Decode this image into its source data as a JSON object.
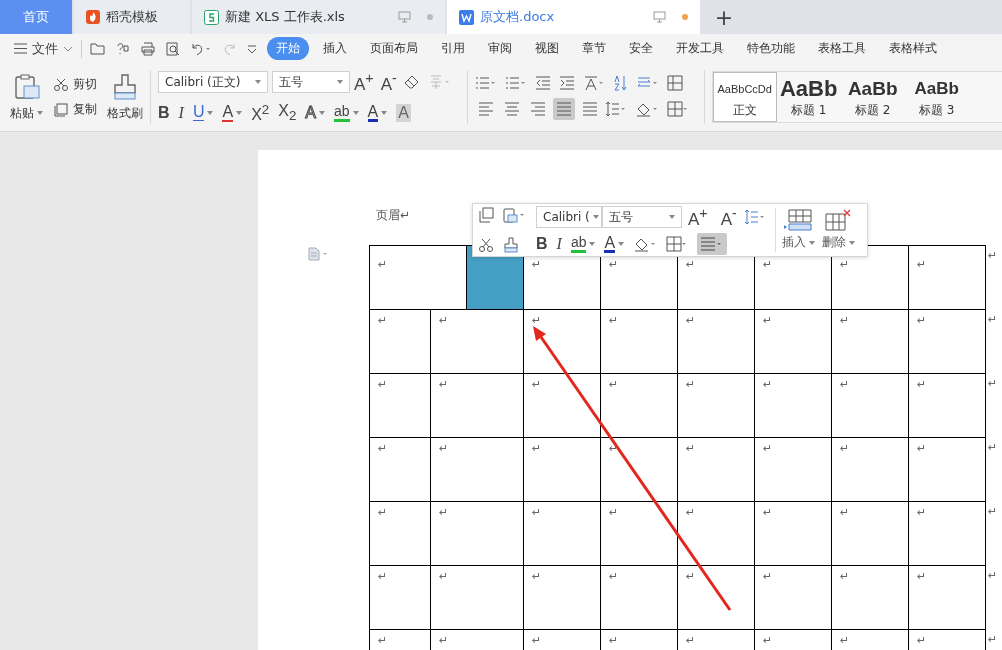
{
  "tabs": [
    {
      "label": "首页",
      "kind": "home",
      "selected": false
    },
    {
      "label": "稻壳模板",
      "kind": "docer",
      "selected": false
    },
    {
      "label": "新建 XLS 工作表.xls",
      "kind": "sheet",
      "selected": false,
      "modified": false
    },
    {
      "label": "原文档.docx",
      "kind": "writer",
      "selected": true,
      "modified": true
    }
  ],
  "new_tab": "+",
  "file_menu": "文件",
  "menu_tabs": [
    {
      "label": "开始",
      "selected": true
    },
    {
      "label": "插入",
      "selected": false
    },
    {
      "label": "页面布局",
      "selected": false
    },
    {
      "label": "引用",
      "selected": false
    },
    {
      "label": "审阅",
      "selected": false
    },
    {
      "label": "视图",
      "selected": false
    },
    {
      "label": "章节",
      "selected": false
    },
    {
      "label": "安全",
      "selected": false
    },
    {
      "label": "开发工具",
      "selected": false
    },
    {
      "label": "特色功能",
      "selected": false
    },
    {
      "label": "表格工具",
      "selected": false
    },
    {
      "label": "表格样式",
      "selected": false
    }
  ],
  "clipboard": {
    "paste": "粘贴",
    "cut": "剪切",
    "copy": "复制",
    "format_painter": "格式刷"
  },
  "font": {
    "family": "Calibri (正文)",
    "size": "五号",
    "grow_shrink": [
      "A$^{+}$",
      "A$^{-}$"
    ]
  },
  "format_buttons": [
    {
      "glyph": "B",
      "kind": "bold",
      "dropdown": false
    },
    {
      "glyph": "I",
      "kind": "italic",
      "dropdown": false
    },
    {
      "glyph": "U",
      "kind": "underline",
      "dropdown": true
    },
    {
      "glyph": "A",
      "kind": "strike",
      "dropdown": true
    },
    {
      "glyph": "X$^{2}$",
      "kind": "plain",
      "dropdown": false
    },
    {
      "glyph": "X$_{2}$",
      "kind": "plain",
      "dropdown": false
    },
    {
      "glyph": "A",
      "kind": "outline",
      "dropdown": true
    },
    {
      "glyph": "ab",
      "kind": "highlight",
      "dropdown": true
    },
    {
      "glyph": "A",
      "kind": "color",
      "dropdown": true
    },
    {
      "glyph": "A",
      "kind": "shade",
      "dropdown": false
    }
  ],
  "align_buttons": [
    {
      "selected": false
    },
    {
      "selected": false
    },
    {
      "selected": false
    },
    {
      "selected": true
    },
    {
      "selected": false
    }
  ],
  "styles": [
    {
      "sample": "AaBbCcDd",
      "label": "正文",
      "kind": "body",
      "selected": true
    },
    {
      "sample": "AaBb",
      "label": "标题 1",
      "kind": "h1",
      "selected": false
    },
    {
      "sample": "AaBb",
      "label": "标题 2",
      "kind": "h2",
      "selected": false
    },
    {
      "sample": "AaBb",
      "label": "标题 3",
      "kind": "h3",
      "selected": false
    }
  ],
  "document": {
    "header": "页眉↵",
    "rows": [
      {
        "cells": [
          {
            "text": "↵",
            "colspan": 2,
            "selected": false
          },
          {
            "selected": true
          },
          {
            "text": "↵",
            "selected": false
          },
          {
            "text": "↵",
            "selected": false
          },
          {
            "text": "↵",
            "selected": false
          },
          {
            "text": "↵",
            "selected": false
          },
          {
            "text": "↵",
            "selected": false
          },
          {
            "text": "↵",
            "selected": false
          }
        ],
        "end_mark": "↵"
      },
      {
        "cells": [
          {
            "text": "↵",
            "selected": false
          },
          {
            "text": "↵",
            "colspan": 2,
            "selected": false
          },
          {
            "text": "↵",
            "selected": false
          },
          {
            "text": "↵",
            "selected": false
          },
          {
            "text": "↵",
            "selected": false
          },
          {
            "text": "↵",
            "selected": false
          },
          {
            "text": "↵",
            "selected": false
          },
          {
            "text": "↵",
            "selected": false
          }
        ],
        "end_mark": "↵"
      },
      {
        "cells": [
          {
            "text": "↵",
            "selected": false
          },
          {
            "text": "↵",
            "colspan": 2,
            "selected": false
          },
          {
            "text": "↵",
            "selected": false
          },
          {
            "text": "↵",
            "selected": false
          },
          {
            "text": "↵",
            "selected": false
          },
          {
            "text": "↵",
            "selected": false
          },
          {
            "text": "↵",
            "selected": false
          },
          {
            "text": "↵",
            "selected": false
          }
        ],
        "end_mark": "↵"
      },
      {
        "cells": [
          {
            "text": "↵",
            "selected": false
          },
          {
            "text": "↵",
            "colspan": 2,
            "selected": false
          },
          {
            "text": "↵",
            "selected": false
          },
          {
            "text": "↵",
            "selected": false
          },
          {
            "text": "↵",
            "selected": false
          },
          {
            "text": "↵",
            "selected": false
          },
          {
            "text": "↵",
            "selected": false
          },
          {
            "text": "↵",
            "selected": false
          }
        ],
        "end_mark": "↵"
      },
      {
        "cells": [
          {
            "text": "↵",
            "selected": false
          },
          {
            "text": "↵",
            "colspan": 2,
            "selected": false
          },
          {
            "text": "↵",
            "selected": false
          },
          {
            "text": "↵",
            "selected": false
          },
          {
            "text": "↵",
            "selected": false
          },
          {
            "text": "↵",
            "selected": false
          },
          {
            "text": "↵",
            "selected": false
          },
          {
            "text": "↵",
            "selected": false
          }
        ],
        "end_mark": "↵"
      },
      {
        "cells": [
          {
            "text": "↵",
            "selected": false
          },
          {
            "text": "↵",
            "colspan": 2,
            "selected": false
          },
          {
            "text": "↵",
            "selected": false
          },
          {
            "text": "↵",
            "selected": false
          },
          {
            "text": "↵",
            "selected": false
          },
          {
            "text": "↵",
            "selected": false
          },
          {
            "text": "↵",
            "selected": false
          },
          {
            "text": "↵",
            "selected": false
          }
        ],
        "end_mark": "↵"
      },
      {
        "cells": [
          {
            "text": "↵",
            "selected": false
          },
          {
            "text": "↵",
            "colspan": 2,
            "selected": false
          },
          {
            "text": "↵",
            "selected": false
          },
          {
            "text": "↵",
            "selected": false
          },
          {
            "text": "↵",
            "selected": false
          },
          {
            "text": "↵",
            "selected": false
          },
          {
            "text": "↵",
            "selected": false
          },
          {
            "text": "↵",
            "selected": false
          }
        ],
        "end_mark": "↵"
      }
    ]
  },
  "mini_toolbar": {
    "font_family": "Calibri (",
    "font_size": "五号",
    "grow_shrink": [
      "A$^{+}$",
      "A$^{-}$"
    ],
    "format_buttons": [
      {
        "glyph": "B",
        "kind": "bold",
        "dropdown": false
      },
      {
        "glyph": "I",
        "kind": "italic",
        "dropdown": false
      },
      {
        "glyph": "ab",
        "kind": "highlight",
        "dropdown": true
      },
      {
        "glyph": "A",
        "kind": "color",
        "dropdown": true
      }
    ],
    "align_active": true,
    "insert": "插入",
    "delete": "删除"
  }
}
